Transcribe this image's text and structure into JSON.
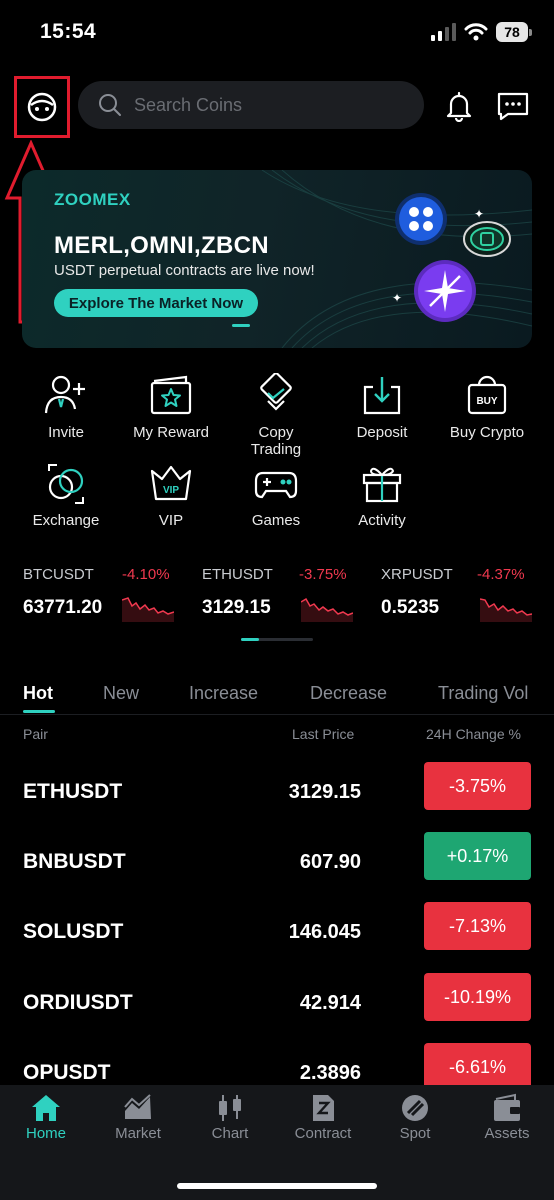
{
  "status_bar": {
    "time": "15:54",
    "battery": "78"
  },
  "header": {
    "search_placeholder": "Search Coins"
  },
  "banner": {
    "brand": "ZOOMEX",
    "title": "MERL,OMNI,ZBCN",
    "subtitle": "USDT perpetual contracts are live now!",
    "cta": "Explore The Market Now"
  },
  "quick_menu": [
    {
      "label": "Invite",
      "icon": "invite-user-icon"
    },
    {
      "label": "My Reward",
      "icon": "reward-card-icon"
    },
    {
      "label": "Copy\nTrading",
      "icon": "copy-trading-icon"
    },
    {
      "label": "Deposit",
      "icon": "deposit-icon"
    },
    {
      "label": "Buy Crypto",
      "icon": "buy-crypto-icon"
    },
    {
      "label": "Exchange",
      "icon": "exchange-icon"
    },
    {
      "label": "VIP",
      "icon": "vip-crown-icon"
    },
    {
      "label": "Games",
      "icon": "gamepad-icon"
    },
    {
      "label": "Activity",
      "icon": "gift-icon"
    }
  ],
  "ticker": [
    {
      "pair": "BTCUSDT",
      "change": "-4.10%",
      "price": "63771.20"
    },
    {
      "pair": "ETHUSDT",
      "change": "-3.75%",
      "price": "3129.15"
    },
    {
      "pair": "XRPUSDT",
      "change": "-4.37%",
      "price": "0.5235"
    }
  ],
  "tabs": [
    "Hot",
    "New",
    "Increase",
    "Decrease",
    "Trading Vol"
  ],
  "table": {
    "headers": {
      "pair": "Pair",
      "price": "Last Price",
      "change": "24H Change %"
    },
    "rows": [
      {
        "pair": "ETHUSDT",
        "price": "3129.15",
        "change": "-3.75%",
        "direction": "down"
      },
      {
        "pair": "BNBUSDT",
        "price": "607.90",
        "change": "+0.17%",
        "direction": "up"
      },
      {
        "pair": "SOLUSDT",
        "price": "146.045",
        "change": "-7.13%",
        "direction": "down"
      },
      {
        "pair": "ORDIUSDT",
        "price": "42.914",
        "change": "-10.19%",
        "direction": "down"
      },
      {
        "pair": "OPUSDT",
        "price": "2.3896",
        "change": "-6.61%",
        "direction": "down"
      }
    ]
  },
  "bottom_nav": [
    {
      "label": "Home",
      "icon": "home-icon",
      "active": true
    },
    {
      "label": "Market",
      "icon": "market-chart-icon",
      "active": false
    },
    {
      "label": "Chart",
      "icon": "candlestick-icon",
      "active": false
    },
    {
      "label": "Contract",
      "icon": "contract-icon",
      "active": false
    },
    {
      "label": "Spot",
      "icon": "spot-icon",
      "active": false
    },
    {
      "label": "Assets",
      "icon": "wallet-icon",
      "active": false
    }
  ],
  "colors": {
    "accent": "#2fd1c0",
    "down": "#e8323f",
    "up": "#1ea672",
    "annotation": "#e01c2e"
  }
}
